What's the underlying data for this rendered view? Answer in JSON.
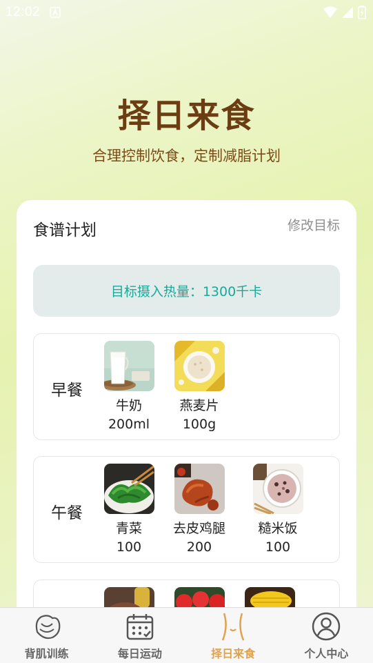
{
  "status_bar": {
    "time": "12:02"
  },
  "hero": {
    "title": "择日来食",
    "subtitle": "合理控制饮食，定制减脂计划"
  },
  "plan_card": {
    "title": "食谱计划",
    "edit_label": "修改目标",
    "target_label": "目标摄入热量：1300千卡",
    "meals": [
      {
        "name": "早餐",
        "foods": [
          {
            "name": "牛奶",
            "amount": "200ml",
            "image": "milk"
          },
          {
            "name": "燕麦片",
            "amount": "100g",
            "image": "oatmeal"
          }
        ]
      },
      {
        "name": "午餐",
        "foods": [
          {
            "name": "青菜",
            "amount": "100",
            "image": "greens"
          },
          {
            "name": "去皮鸡腿",
            "amount": "200",
            "image": "chicken-leg"
          },
          {
            "name": "糙米饭",
            "amount": "100",
            "image": "brown-rice"
          }
        ]
      },
      {
        "name": "",
        "foods": [
          {
            "name": "",
            "amount": "",
            "image": "steak"
          },
          {
            "name": "",
            "amount": "",
            "image": "tomatoes"
          },
          {
            "name": "",
            "amount": "",
            "image": "corn"
          }
        ]
      }
    ]
  },
  "tabbar": {
    "active_color": "#e0a24a",
    "tabs": [
      {
        "label": "背肌训练",
        "icon": "back-muscle-icon"
      },
      {
        "label": "每日运动",
        "icon": "calendar-icon"
      },
      {
        "label": "择日来食",
        "icon": "waist-icon",
        "active": true
      },
      {
        "label": "个人中心",
        "icon": "person-icon"
      }
    ]
  },
  "colors": {
    "title_brown": "#6a3d12",
    "target_teal": "#1aa89a",
    "muted_gray": "#8f8f8f"
  }
}
